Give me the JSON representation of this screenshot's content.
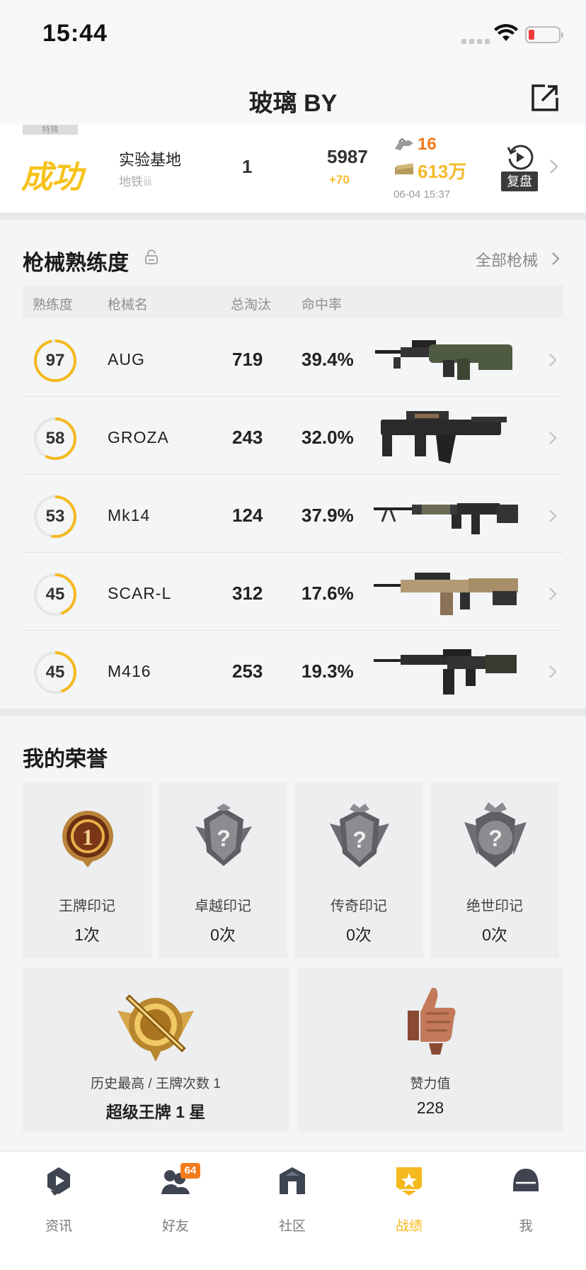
{
  "status": {
    "time": "15:44"
  },
  "header": {
    "title": "玻璃 BY"
  },
  "match": {
    "tag": "特殊",
    "result": "成功",
    "map": "实验基地",
    "mode": "地铁",
    "rank": "1",
    "score": "5987",
    "score_delta": "+70",
    "kills": "16",
    "cash": "613万",
    "datetime": "06-04 15:37",
    "replay_label": "复盘"
  },
  "weapons": {
    "title": "枪械熟练度",
    "all_label": "全部枪械",
    "columns": [
      "熟练度",
      "枪械名",
      "总淘汰",
      "命中率"
    ],
    "rows": [
      {
        "mastery": "97",
        "mastery_pct": 0.97,
        "name": "AUG",
        "kills": "719",
        "accuracy": "39.4%"
      },
      {
        "mastery": "58",
        "mastery_pct": 0.58,
        "name": "GROZA",
        "kills": "243",
        "accuracy": "32.0%"
      },
      {
        "mastery": "53",
        "mastery_pct": 0.53,
        "name": "Mk14",
        "kills": "124",
        "accuracy": "37.9%"
      },
      {
        "mastery": "45",
        "mastery_pct": 0.45,
        "name": "SCAR-L",
        "kills": "312",
        "accuracy": "17.6%"
      },
      {
        "mastery": "45",
        "mastery_pct": 0.45,
        "name": "M416",
        "kills": "253",
        "accuracy": "19.3%"
      }
    ]
  },
  "honors": {
    "title": "我的荣誉",
    "badges": [
      {
        "name": "王牌印记",
        "count": "1次",
        "icon": "ace-mark-icon"
      },
      {
        "name": "卓越印记",
        "count": "0次",
        "icon": "excellence-mark-icon"
      },
      {
        "name": "传奇印记",
        "count": "0次",
        "icon": "legend-mark-icon"
      },
      {
        "name": "绝世印记",
        "count": "0次",
        "icon": "peerless-mark-icon"
      }
    ],
    "best": {
      "label": "历史最高 / 王牌次数 1",
      "value": "超级王牌 1 星",
      "icon": "super-ace-emblem-icon"
    },
    "likes": {
      "label": "赞力值",
      "value": "228",
      "icon": "thumbs-up-icon"
    }
  },
  "tabs": [
    {
      "label": "资讯",
      "icon": "news-icon"
    },
    {
      "label": "好友",
      "icon": "friends-icon",
      "badge": "64"
    },
    {
      "label": "社区",
      "icon": "community-icon"
    },
    {
      "label": "战绩",
      "icon": "record-icon",
      "active": true
    },
    {
      "label": "我",
      "icon": "helmet-icon"
    }
  ],
  "colors": {
    "accent": "#f5b91e",
    "kill": "#f27b1c",
    "result": "#f7c31b",
    "ring_track": "#e6e6e6"
  }
}
